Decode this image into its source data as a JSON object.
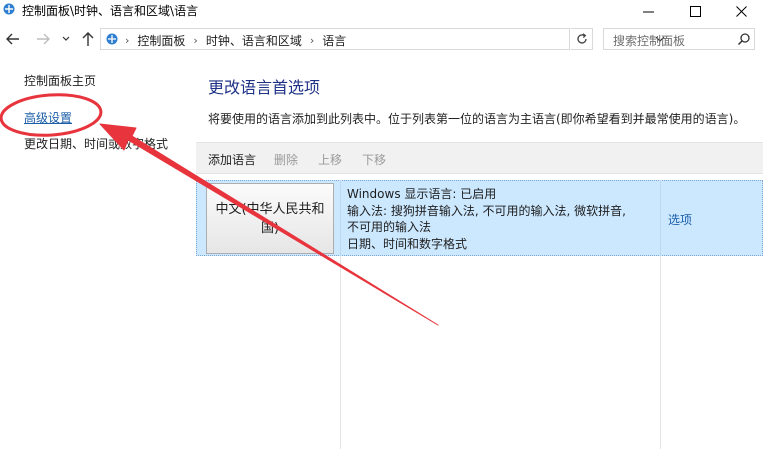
{
  "window": {
    "title": "控制面板\\时钟、语言和区域\\语言"
  },
  "address": {
    "crumbs": [
      "控制面板",
      "时钟、语言和区域",
      "语言"
    ],
    "separator": "›"
  },
  "search": {
    "placeholder": "搜索控制面板"
  },
  "sidebar": {
    "items": [
      {
        "label": "控制面板主页"
      },
      {
        "label": "高级设置"
      },
      {
        "label": "更改日期、时间或数字格式"
      }
    ]
  },
  "main": {
    "title": "更改语言首选项",
    "description": "将要使用的语言添加到此列表中。位于列表第一位的语言为主语言(即你希望看到并最常使用的语言)。",
    "toolbar": {
      "add": "添加语言",
      "remove": "删除",
      "move_up": "上移",
      "move_down": "下移"
    },
    "languages": [
      {
        "name": "中文(中华人民共和国)",
        "details": [
          "Windows 显示语言: 已启用",
          "输入法: 搜狗拼音输入法, 不可用的输入法, 微软拼音,",
          "不可用的输入法",
          "日期、时间和数字格式"
        ],
        "options_label": "选项"
      }
    ]
  },
  "colors": {
    "link": "#1a5ea8",
    "title": "#1e3287",
    "selected_row": "#cce8ff",
    "annotation": "#e8343d"
  },
  "icons": {
    "window": "control-panel-icon",
    "back": "arrow-left-icon",
    "forward": "arrow-right-icon",
    "recent": "chevron-down-icon",
    "up": "arrow-up-icon",
    "refresh": "refresh-icon",
    "search": "search-icon"
  }
}
